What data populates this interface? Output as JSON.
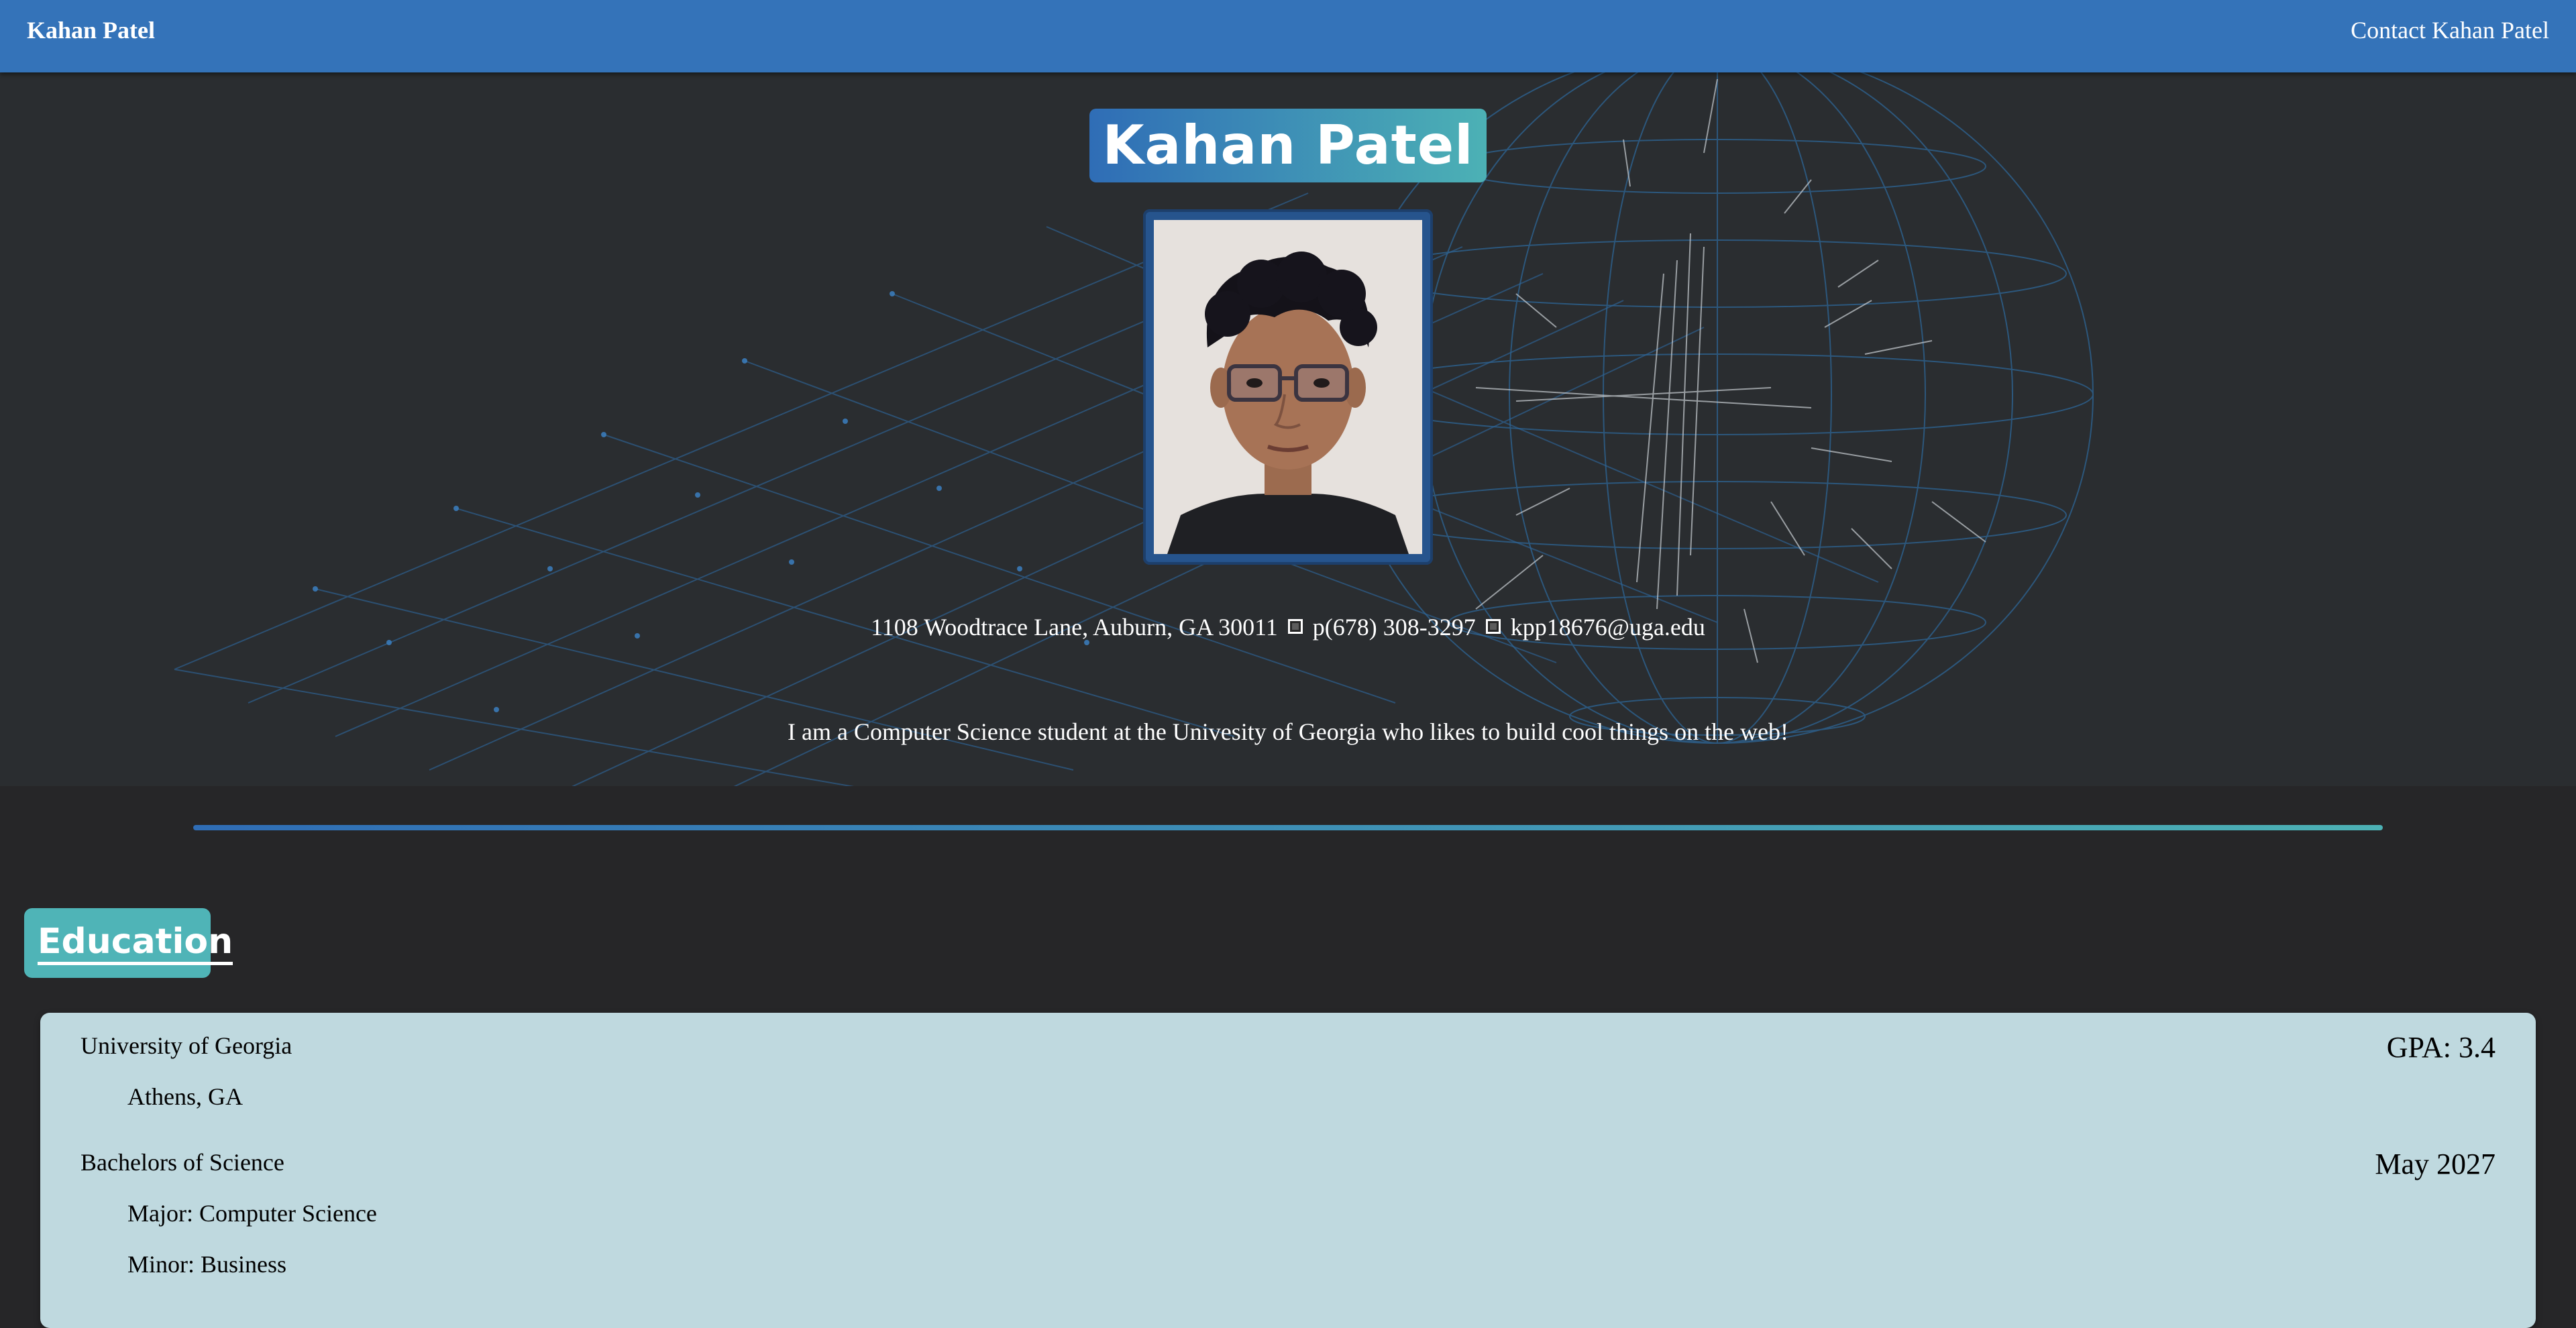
{
  "nav": {
    "brand": "Kahan Patel",
    "contact": "Contact Kahan Patel"
  },
  "hero": {
    "name": "Kahan Patel",
    "address": "1108 Woodtrace Lane, Auburn, GA 30011",
    "phone": "p(678) 308-3297",
    "email": "kpp18676@uga.edu",
    "tagline": "I am a Computer Science student at the Univesity of Georgia who likes to build cool things on the web!"
  },
  "education": {
    "heading": "Education",
    "school": "University of Georgia",
    "location": "Athens, GA",
    "gpa": "GPA: 3.4",
    "degree": "Bachelors of Science",
    "grad_date": "May 2027",
    "major": "Major: Computer Science",
    "minor": "Minor: Business"
  },
  "colors": {
    "navbar": "#3473b9",
    "accent_start": "#2f6db6",
    "accent_end": "#4cb1b5",
    "page_bg": "#262628",
    "card_bg": "#bfd9df"
  }
}
